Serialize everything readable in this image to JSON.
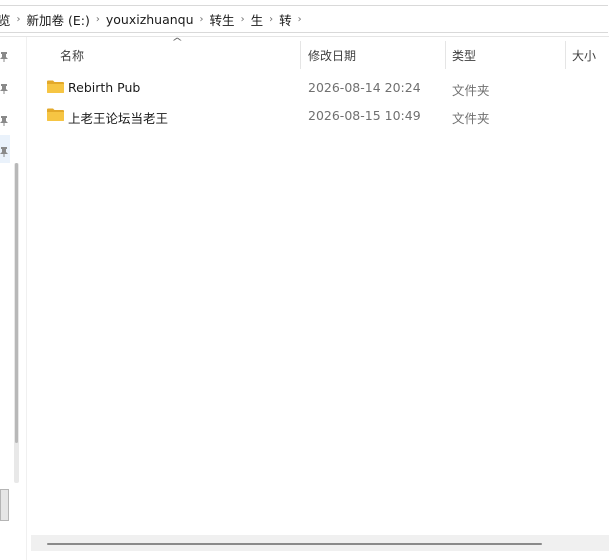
{
  "breadcrumb": {
    "items": [
      "览",
      "新加卷 (E:)",
      "youxizhuanqu",
      "转生",
      "生",
      "转"
    ],
    "separator": "›"
  },
  "columns": {
    "name": "名称",
    "modified": "修改日期",
    "type": "类型",
    "size": "大小"
  },
  "files": [
    {
      "name": "Rebirth Pub",
      "modified": "2026-08-14 20:24",
      "type": "文件夹"
    },
    {
      "name": "上老王论坛当老王",
      "modified": "2026-08-15 10:49",
      "type": "文件夹"
    }
  ],
  "colors": {
    "folder": "#f6c543",
    "folder_dark": "#e3a92a",
    "nav_selected": "#eaf2fb"
  },
  "icons": [
    "pin-icon",
    "folder-icon",
    "sort-up-icon",
    "chevron-right-icon"
  ]
}
